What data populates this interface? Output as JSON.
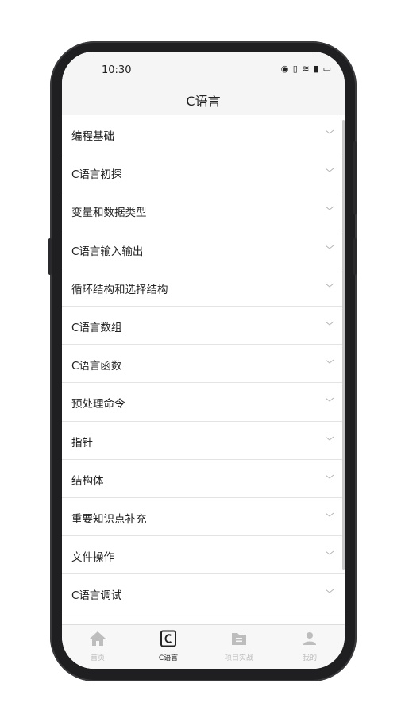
{
  "status": {
    "time": "10:30",
    "icons": "◉ ▯ ≋ ▮ ▭"
  },
  "header": {
    "title": "C语言"
  },
  "chapters": [
    "编程基础",
    "C语言初探",
    "变量和数据类型",
    "C语言输入输出",
    "循环结构和选择结构",
    "C语言数组",
    "C语言函数",
    "预处理命令",
    "指针",
    "结构体",
    "重要知识点补充",
    "文件操作",
    "C语言调试"
  ],
  "tabs": [
    {
      "label": "首页",
      "icon": "home-icon"
    },
    {
      "label": "C语言",
      "icon": "c-language-icon"
    },
    {
      "label": "项目实战",
      "icon": "folder-icon"
    },
    {
      "label": "我的",
      "icon": "user-icon"
    }
  ],
  "colors": {
    "active": "#222222",
    "inactive": "#bbbbbb",
    "background": "#f5f5f5"
  }
}
